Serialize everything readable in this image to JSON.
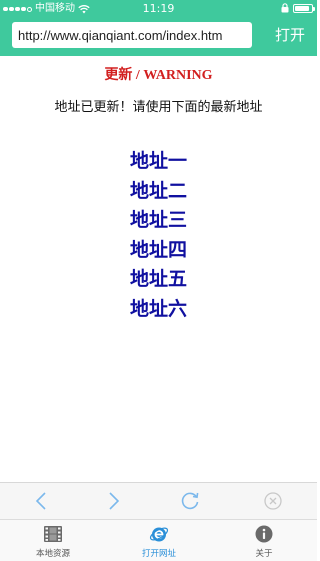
{
  "status_bar": {
    "carrier": "中国移动",
    "time": "11:19",
    "signal_bars_filled": 4,
    "signal_bars_total": 5,
    "battery_level": 0.9
  },
  "address_bar": {
    "url": "http://www.qianqiant.com/index.htm",
    "open_label": "打开"
  },
  "page": {
    "heading": "更新 / WARNING",
    "notice": "地址已更新！请使用下面的最新地址",
    "links": [
      {
        "label": "地址一"
      },
      {
        "label": "地址二"
      },
      {
        "label": "地址三"
      },
      {
        "label": "地址四"
      },
      {
        "label": "地址五"
      },
      {
        "label": "地址六"
      }
    ]
  },
  "toolbar": {
    "back_icon": "chevron-left-icon",
    "forward_icon": "chevron-right-icon",
    "refresh_icon": "refresh-icon",
    "stop_icon": "close-circle-icon",
    "icon_color": "#7bb8ec",
    "disabled_color": "#c8c8c8"
  },
  "tabbar": {
    "tabs": [
      {
        "label": "本地资源",
        "icon": "film-icon",
        "active": false
      },
      {
        "label": "打开网址",
        "icon": "browser-e-icon",
        "active": true
      },
      {
        "label": "关于",
        "icon": "info-icon",
        "active": false
      }
    ],
    "active_color": "#2a8fd8"
  },
  "colors": {
    "brand_green": "#3fc99d",
    "warning_red": "#d21f1f",
    "link_blue": "#1010a0"
  }
}
